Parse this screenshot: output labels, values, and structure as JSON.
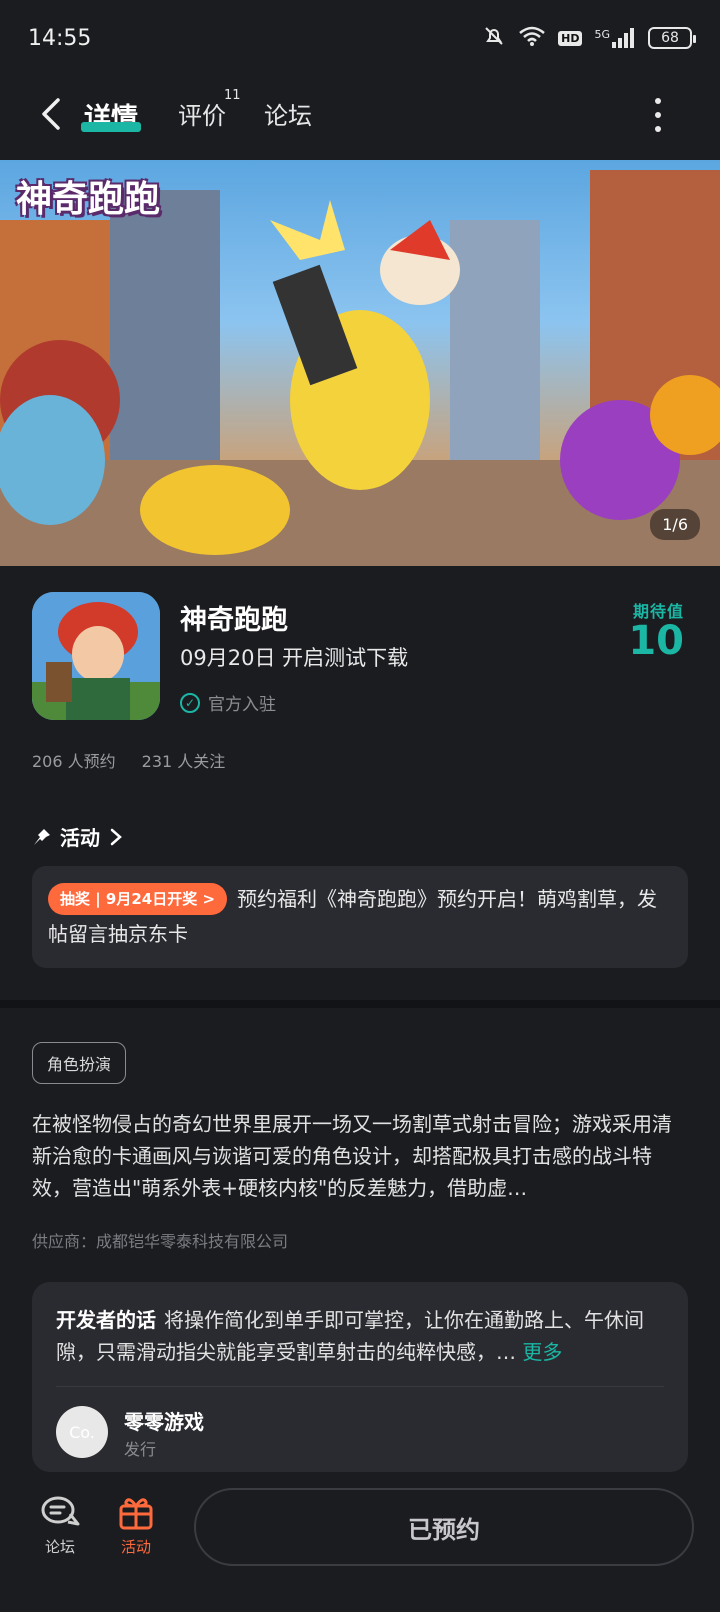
{
  "status": {
    "time": "14:55",
    "hd": "HD",
    "network": "5G",
    "battery": "68"
  },
  "nav": {
    "tabs": [
      {
        "label": "详情",
        "active": true
      },
      {
        "label": "评价",
        "badge": "11"
      },
      {
        "label": "论坛"
      }
    ]
  },
  "hero": {
    "logo": "神奇跑跑",
    "counter": "1/6"
  },
  "game": {
    "title": "神奇跑跑",
    "subtitle": "09月20日 开启测试下载",
    "official": "官方入驻",
    "expect_label": "期待值",
    "expect_value": "10",
    "reservations": "206 人预约",
    "followers": "231 人关注"
  },
  "activity": {
    "heading": "活动",
    "pill": "抽奖 | 9月24日开奖 >",
    "text": "预约福利《神奇跑跑》预约开启！萌鸡割草，发帖留言抽京东卡"
  },
  "details": {
    "tag": "角色扮演",
    "description": "在被怪物侵占的奇幻世界里展开一场又一场割草式射击冒险；游戏采用清新治愈的卡通画风与诙谐可爱的角色设计，却搭配极具打击感的战斗特效，营造出\"萌系外表+硬核内核\"的反差魅力，借助虚…",
    "supplier": "供应商：成都铠华零泰科技有限公司"
  },
  "developer": {
    "label": "开发者的话",
    "text": "将操作简化到单手即可掌控，让你在通勤路上、午休间隙，只需滑动指尖就能享受割草射击的纯粹快感，…",
    "more": "更多",
    "publisher_avatar": "Co.",
    "publisher_name": "零零游戏",
    "publisher_role": "发行"
  },
  "bottom": {
    "forum_label": "论坛",
    "activity_label": "活动",
    "reserve_button": "已预约"
  },
  "colors": {
    "accent": "#1bb6a4",
    "orange": "#ff6a3d",
    "background": "#1b1c20",
    "card": "#2a2b30"
  }
}
